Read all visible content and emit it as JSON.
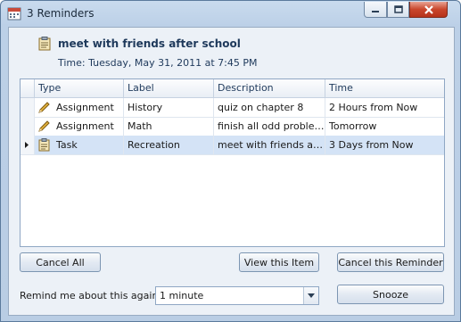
{
  "window": {
    "title": "3 Reminders"
  },
  "header": {
    "subject": "meet with friends after school",
    "time": "Time: Tuesday, May 31, 2011 at 7:45 PM"
  },
  "grid": {
    "columns": [
      "Type",
      "Label",
      "Description",
      "Time"
    ],
    "rows": [
      {
        "icon": "pencil-icon",
        "type": "Assignment",
        "label": "History",
        "description": "quiz on chapter 8",
        "time": "2 Hours from Now",
        "selected": false
      },
      {
        "icon": "pencil-icon",
        "type": "Assignment",
        "label": "Math",
        "description": "finish all odd problems...",
        "time": "Tomorrow",
        "selected": false
      },
      {
        "icon": "clipboard-icon",
        "type": "Task",
        "label": "Recreation",
        "description": "meet with friends afte...",
        "time": "3 Days from Now",
        "selected": true
      }
    ]
  },
  "buttons": {
    "cancel_all": "Cancel All",
    "view_item": "View this Item",
    "cancel_reminder": "Cancel this Reminder",
    "snooze": "Snooze"
  },
  "remind": {
    "label": "Remind me about this again in:",
    "value": "1 minute"
  },
  "colors": {
    "selection": "#d4e3f6",
    "accent": "#1e395b"
  }
}
